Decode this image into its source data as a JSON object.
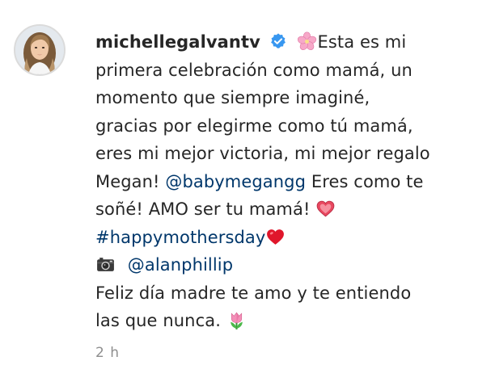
{
  "post": {
    "username": "michellegalvantv",
    "verified_icon": "verified-badge-icon",
    "caption": {
      "l1_text": "Esta es mi",
      "l2_text": "primera celebración como mamá, un",
      "l3_text": "momento que siempre imaginé,",
      "l4_text": "gracias por elegirme como tú mamá,",
      "l5_text": "eres mi mejor victoria, mi mejor regalo",
      "l6_before": "Megan! ",
      "l6_mention": "@babymegangg",
      "l6_after": " Eres como te",
      "l7_text": "soñé! AMO ser tu mamá! ",
      "l8_hashtag": "#happymothersday",
      "l9_mention": "@alanphillip",
      "l10_text": "Feliz día madre te amo y te entiendo",
      "l11_text": "las que nunca. "
    },
    "emojis": {
      "flower": "cherry-blossom-icon",
      "heart": "heart-icon",
      "heart_red": "red-heart-icon",
      "camera": "camera-icon",
      "tulip": "tulip-icon"
    },
    "timestamp": "2 h"
  },
  "colors": {
    "text": "#262626",
    "link": "#00376b",
    "muted": "#8e8e8e",
    "verified": "#3897f0"
  }
}
